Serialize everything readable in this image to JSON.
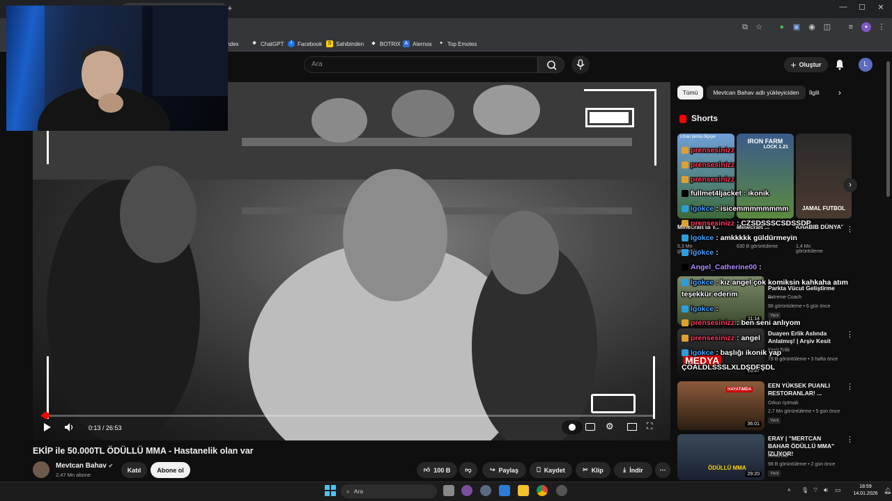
{
  "browser": {
    "new_tab": "+",
    "window_controls": [
      "—",
      "☐",
      "✕"
    ],
    "bookmarks": [
      {
        "label": "Yandex",
        "icon": "yandex-icon",
        "color": "#35363a"
      },
      {
        "label": "ChatGPT",
        "icon": "chatgpt-icon",
        "color": "#35363a"
      },
      {
        "label": "Facebook",
        "icon": "facebook-icon",
        "color": "#1877f2"
      },
      {
        "label": "Sahibinden",
        "icon": "sahibinden-icon",
        "color": "#ffd400"
      },
      {
        "label": "BOTRIX",
        "icon": "botrix-icon",
        "color": "#35363a"
      },
      {
        "label": "Aternos",
        "icon": "aternos-icon",
        "color": "#2d6ad6"
      },
      {
        "label": "Top Emotes",
        "icon": "top-emotes-icon",
        "color": "#35363a"
      }
    ]
  },
  "header": {
    "search_placeholder": "Ara",
    "create_label": "Oluştur",
    "avatar_letter": "L"
  },
  "player": {
    "time": "0:13 / 26:53",
    "progress": 0.008
  },
  "video": {
    "title": "EKİP ile 50.000TL ÖDÜLLÜ MMA - Hastanelik olan var",
    "channel": "Mevtcan Bahav",
    "subscribers": "2,47 Mn abone",
    "join_label": "Katıl",
    "subscribe_label": "Abone ol",
    "likes": "100 B",
    "share_label": "Paylaş",
    "save_label": "Kaydet",
    "clip_label": "Klip",
    "download_label": "İndir"
  },
  "sidebar": {
    "chips": [
      "Tümü",
      "Mevtcan Bahav adlı yükleyiciden",
      "İlgili"
    ],
    "shorts_title": "Shorts",
    "shorts": [
      {
        "top_text": "Lmao perka ölçeye",
        "title": "Minecraft'ta Y...",
        "views": "5,3 Mn görüntüleme"
      },
      {
        "top_text": "IRON FARM",
        "sub_text": "LOCK 1.21",
        "title": "Minecraft ...",
        "views": "630 B görüntüleme"
      },
      {
        "top_text": "JAMAL FUTBOL",
        "title": "KHABIB DÜNYA'YA ...",
        "views": "1,4 Mn görüntüleme"
      }
    ],
    "recommendations": [
      {
        "title": "Parkta Vücut Geliştirme ...",
        "channel": "Extreme Coach",
        "meta": "98 görüntüleme • 6 gün önce",
        "badge": "Yeni",
        "duration": "11:14"
      },
      {
        "title": "Duayen Erlik Aslında Anlatmış! | Arşiv Kesit",
        "channel": "Kesit Erlik",
        "meta": "79 B görüntüleme • 3 hafta önce",
        "badge": "",
        "duration": "26:47",
        "thumb_text": "MEDYA"
      },
      {
        "title": "EEN YÜKSEK PUANLI RESTORANLAR! ...",
        "channel": "Orkun Işıtmak",
        "meta": "2,7 Mn görüntüleme • 5 gün önce",
        "badge": "Yeni",
        "duration": "36:01",
        "thumb_text": "HAYATIMDA"
      },
      {
        "title": "ERAY | \"MERTCAN BAHAR ÖDÜLLÜ MMA\" İZLİYOR!",
        "channel": "KesitHub",
        "meta": "98 B görüntüleme • 2 gün önce",
        "badge": "Yeni",
        "duration": "29:20",
        "thumb_text": "ÖDÜLLÜ MMA"
      }
    ]
  },
  "chat": [
    {
      "user": "prensesinizz",
      "msg": "",
      "color": "red"
    },
    {
      "user": "prensesinizz",
      "msg": "",
      "color": "red"
    },
    {
      "user": "prensesinizz",
      "msg": "",
      "color": "red"
    },
    {
      "user": "fullmet4ljacket",
      "msg": ": ikonik",
      "color": "white"
    },
    {
      "user": "lgokce",
      "msg": ": isicemmmmmmmm",
      "color": "blue"
    },
    {
      "user": "prensesinizz",
      "msg": ": CZSDSSSCSDSSDP",
      "color": "red"
    },
    {
      "user": "lgokce",
      "msg": ": amkkkkk güldürmeyin",
      "color": "blue"
    },
    {
      "user": "lgokce",
      "msg": ":",
      "color": "blue"
    },
    {
      "user": "Angel_Catherine00",
      "msg": ":",
      "color": "purple"
    },
    {
      "user": "lgokce",
      "msg": ": kız angel çok komiksin kahkaha atım",
      "color": "blue"
    },
    {
      "user": "",
      "msg": "teşekkür ederim",
      "color": "white"
    },
    {
      "user": "lgokce",
      "msg": ":",
      "color": "blue"
    },
    {
      "user": "prensesinizz",
      "msg": ": ben seni anlıyom",
      "color": "red"
    },
    {
      "user": "prensesinizz",
      "msg": ": angel",
      "color": "red"
    },
    {
      "user": "lgokce",
      "msg": ": başlığı ikonik yap",
      "color": "blue"
    },
    {
      "user": "",
      "msg": "ÇÖALDLSSSLXLDŞDFŞDL",
      "color": "white"
    }
  ],
  "taskbar": {
    "search_label": "Ara",
    "time": "18:59",
    "date": "14.01.2026"
  },
  "colors": {
    "accent_red": "#ff0000",
    "background": "#0f0f0f",
    "chip_bg": "#272727"
  }
}
